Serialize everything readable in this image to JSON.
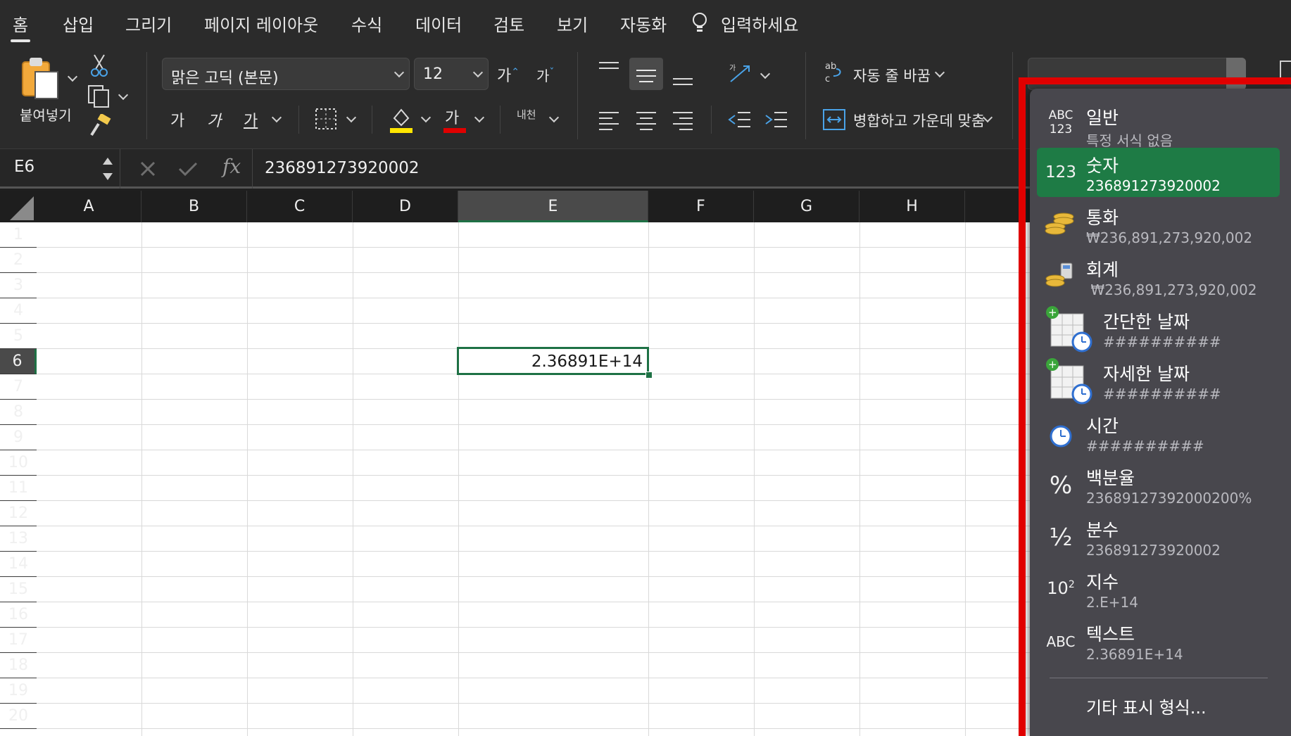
{
  "tabs": [
    {
      "label": "홈",
      "active": true
    },
    {
      "label": "삽입"
    },
    {
      "label": "그리기"
    },
    {
      "label": "페이지 레이아웃"
    },
    {
      "label": "수식"
    },
    {
      "label": "데이터"
    },
    {
      "label": "검토"
    },
    {
      "label": "보기"
    },
    {
      "label": "자동화"
    }
  ],
  "tell_me": {
    "label": "입력하세요"
  },
  "ribbon": {
    "paste_label": "붙여넣기",
    "font_name": "맑은 고딕 (본문)",
    "font_size": "12",
    "grow_font": "가",
    "shrink_font": "가",
    "bold": "가",
    "italic": "가",
    "underline": "가",
    "font_color_glyph": "가",
    "phonetic": "내천",
    "wrap_text": "자동 줄 바꿈",
    "merge_center": "병합하고 가운데 맞춤"
  },
  "formula_bar": {
    "name_box": "E6",
    "fx": "fx",
    "content": "236891273920002"
  },
  "columns": [
    "A",
    "B",
    "C",
    "D",
    "E",
    "F",
    "G",
    "H"
  ],
  "selected_column": "E",
  "rows": [
    "1",
    "2",
    "3",
    "4",
    "5",
    "6",
    "7",
    "8",
    "9",
    "10",
    "11",
    "12",
    "13",
    "14",
    "15",
    "16",
    "17",
    "18",
    "19",
    "20"
  ],
  "selected_row": "6",
  "cells": {
    "E6": "2.36891E+14"
  },
  "number_format_menu": {
    "items": [
      {
        "label": "일반",
        "sub": "특정 서식 없음",
        "icon": "abc-123-icon"
      },
      {
        "label": "숫자",
        "sub": "236891273920002",
        "icon": "123-icon",
        "selected": true
      },
      {
        "label": "통화",
        "sub": "₩236,891,273,920,002",
        "icon": "coins-icon"
      },
      {
        "label": "회계",
        "sub": " ₩236,891,273,920,002",
        "icon": "calculator-coins-icon"
      },
      {
        "label": "간단한 날짜",
        "sub": "##########",
        "icon": "calendar-clock-icon"
      },
      {
        "label": "자세한 날짜",
        "sub": "##########",
        "icon": "calendar-clock-icon"
      },
      {
        "label": "시간",
        "sub": "##########",
        "icon": "clock-icon"
      },
      {
        "label": "백분율",
        "sub": "23689127392000200%",
        "icon": "percent-icon"
      },
      {
        "label": "분수",
        "sub": "236891273920002",
        "icon": "fraction-icon"
      },
      {
        "label": "지수",
        "sub": "2.E+14",
        "icon": "exponent-icon"
      },
      {
        "label": "텍스트",
        "sub": "2.36891E+14",
        "icon": "abc-icon"
      }
    ],
    "more": "기타 표시 형식...",
    "icon_text": {
      "abc": "ABC",
      "n123": "123",
      "percent": "%",
      "fraction": "½",
      "exp_base": "10",
      "exp_pow": "2"
    }
  },
  "colors": {
    "accent_green": "#1e7b45",
    "highlight_red": "#e00000",
    "fill_yellow": "#ffe600",
    "font_red": "#e00000"
  }
}
